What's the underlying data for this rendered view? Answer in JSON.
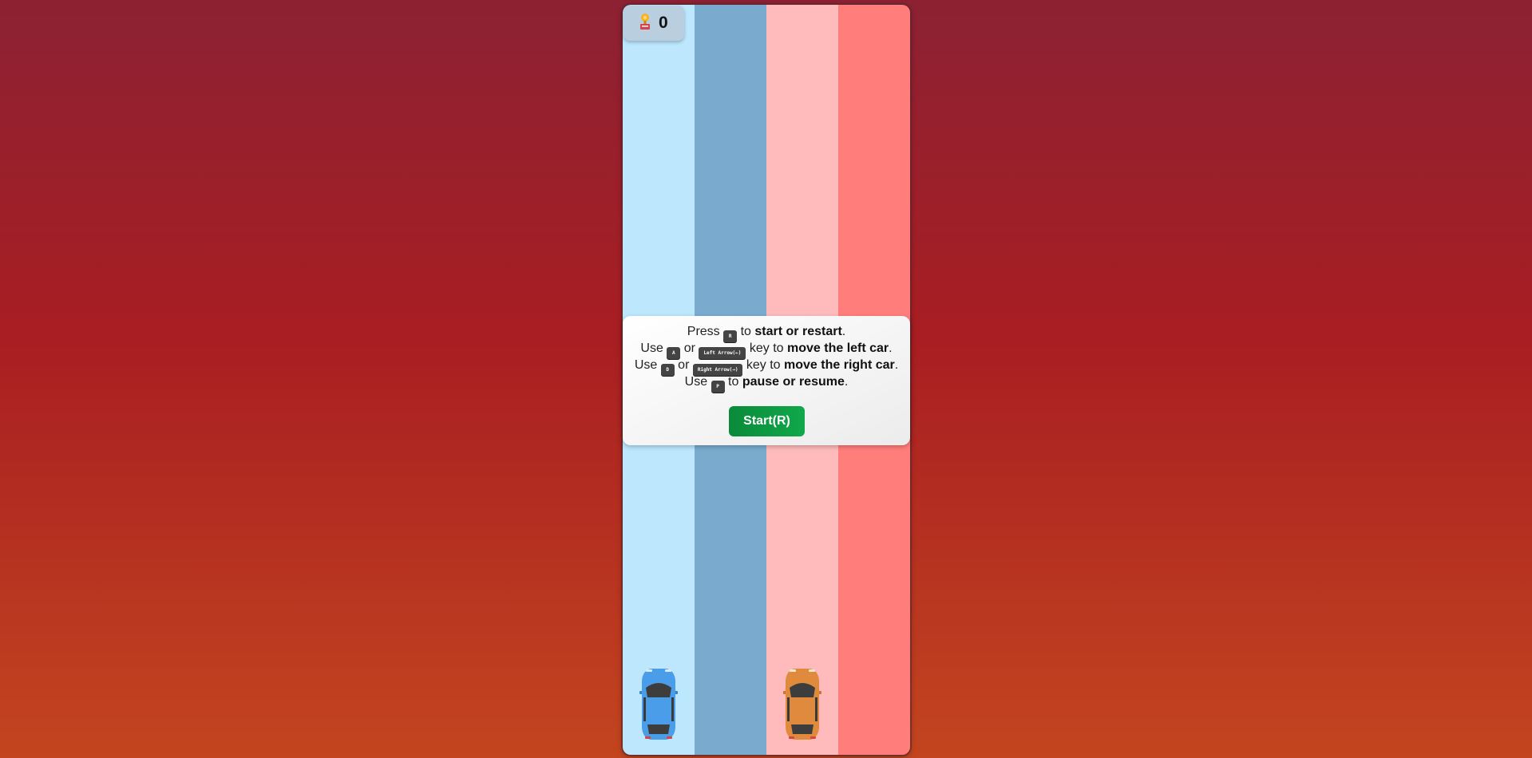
{
  "game": {
    "score": "0",
    "score_icon": "trophy-icon",
    "lane_colors": [
      "#bde7fd",
      "#7aabcf",
      "#ffbbbb",
      "#ff7e7c"
    ],
    "left_car_color": "#4a9de8",
    "right_car_color": "#df8a3c"
  },
  "instructions": {
    "line1": {
      "prefix": "Press",
      "key": "R",
      "mid": "to",
      "action": "start or restart",
      "suffix": "."
    },
    "line2": {
      "prefix": "Use",
      "key1": "A",
      "or": "or",
      "key2": "Left Arrow(←)",
      "mid": "key to",
      "action": "move the left car",
      "suffix": "."
    },
    "line3": {
      "prefix": "Use",
      "key1": "D",
      "or": "or",
      "key2": "Right Arrow(→)",
      "mid": "key to",
      "action": "move the right car",
      "suffix": "."
    },
    "line4": {
      "prefix": "Use",
      "key": "P",
      "mid": "to",
      "action": "pause or resume",
      "suffix": "."
    }
  },
  "start_button": {
    "label": "Start(R)"
  }
}
